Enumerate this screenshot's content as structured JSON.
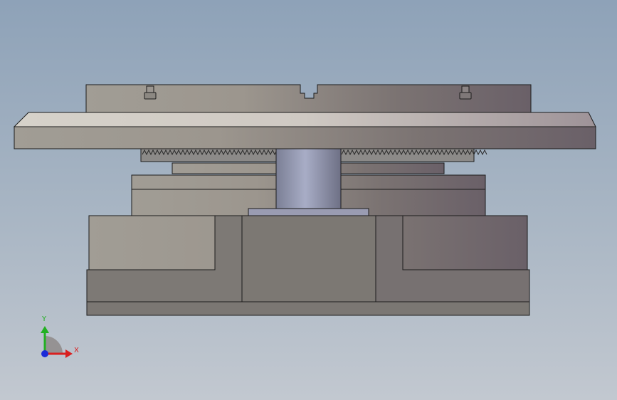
{
  "viewport": {
    "background_top": "#8ea2b8",
    "background_bottom": "#c2c8d0"
  },
  "model": {
    "description_parts": [
      "top-plate",
      "upper-table",
      "gear-rack",
      "center-column",
      "middle-block",
      "base-block",
      "base-foot"
    ]
  },
  "triad": {
    "y_label": "Y",
    "x_label": "X",
    "y_color": "#22b022",
    "x_color": "#d92020",
    "z_color": "#1c2bd8"
  }
}
